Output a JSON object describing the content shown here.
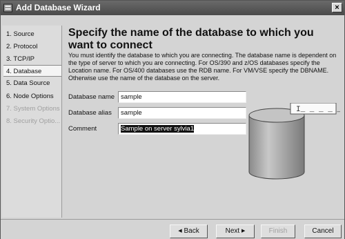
{
  "window": {
    "title": "Add Database Wizard",
    "close_glyph": "×"
  },
  "nav": {
    "items": [
      {
        "label": "1. Source",
        "state": "normal"
      },
      {
        "label": "2. Protocol",
        "state": "normal"
      },
      {
        "label": "3. TCP/IP",
        "state": "normal"
      },
      {
        "label": "4. Database",
        "state": "selected"
      },
      {
        "label": "5. Data Source",
        "state": "normal"
      },
      {
        "label": "6. Node Options",
        "state": "normal"
      },
      {
        "label": "7. System Options",
        "state": "disabled"
      },
      {
        "label": "8. Security Optio...",
        "state": "disabled"
      }
    ]
  },
  "main": {
    "heading": "Specify the name of the database to which you want to connect",
    "description": "You must identify the database to which you are connecting. The database name is dependent on the type of server to which you are connecting. For OS/390 and z/OS databases specify the Location name. For OS/400 databases use the RDB name. For VM/VSE specify the DBNAME. Otherwise use the name of the database on the server.",
    "fields": {
      "database_name": {
        "label": "Database name",
        "value": "sample"
      },
      "database_alias": {
        "label": "Database alias",
        "value": "sample"
      },
      "comment": {
        "label": "Comment",
        "value": "Sample on server sylvia1"
      }
    },
    "illustration": {
      "icon": "database-cylinder-icon",
      "label_glyph": "I_ _ _ _ _"
    }
  },
  "footer": {
    "back_label": "Back",
    "next_label": "Next",
    "finish_label": "Finish",
    "cancel_label": "Cancel"
  },
  "colors": {
    "title_bar": "#5a5a5a",
    "window_bg": "#d4d4d4",
    "cylinder": "#b0b0b0"
  }
}
